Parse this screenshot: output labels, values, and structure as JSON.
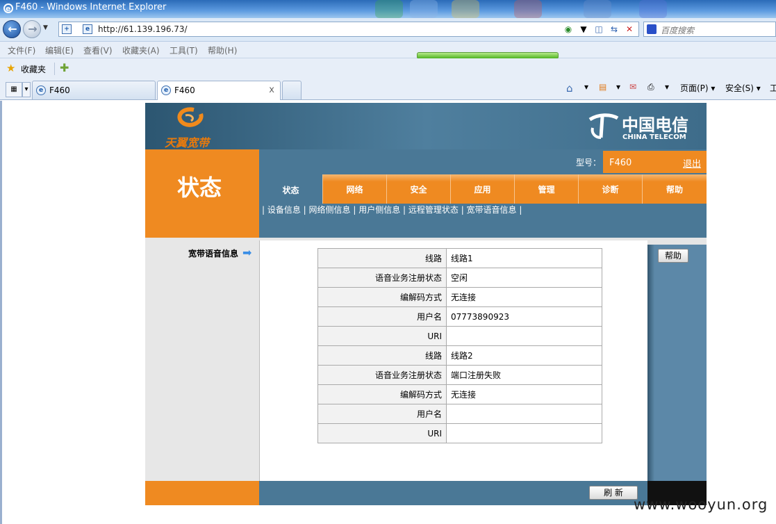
{
  "browser": {
    "window_title": "F460 - Windows Internet Explorer",
    "url": "http://61.139.196.73/",
    "search_placeholder": "百度搜索",
    "menu": [
      "文件(F)",
      "编辑(E)",
      "查看(V)",
      "收藏夹(A)",
      "工具(T)",
      "帮助(H)"
    ],
    "favorites_label": "收藏夹",
    "tabs": [
      {
        "label": "F460"
      },
      {
        "label": "F460",
        "close": "x"
      }
    ],
    "cmdbar": {
      "page": "页面(P) ▾",
      "safety": "安全(S) ▾",
      "tools": "工"
    }
  },
  "router": {
    "brand_cn": "天翼宽带",
    "operator_cn": "中国电信",
    "operator_en": "CHINA TELECOM",
    "section_title": "状态",
    "model_label": "型号：",
    "model_value": "F460",
    "logout": "退出",
    "tabs": [
      "状态",
      "网络",
      "安全",
      "应用",
      "管理",
      "诊断",
      "帮助"
    ],
    "sublinks": "| 设备信息 | 网络侧信息 | 用户侧信息 | 远程管理状态 | 宽带语音信息 |",
    "side_item": "宽带语音信息",
    "help_button": "帮助",
    "refresh_button": "刷 新",
    "rows": [
      {
        "label": "线路",
        "value": "线路1"
      },
      {
        "label": "语音业务注册状态",
        "value": "空闲"
      },
      {
        "label": "编解码方式",
        "value": "无连接"
      },
      {
        "label": "用户名",
        "value": "07773890923"
      },
      {
        "label": "URI",
        "value": ""
      },
      {
        "label": "线路",
        "value": "线路2"
      },
      {
        "label": "语音业务注册状态",
        "value": "端口注册失败"
      },
      {
        "label": "编解码方式",
        "value": "无连接"
      },
      {
        "label": "用户名",
        "value": ""
      },
      {
        "label": "URI",
        "value": ""
      }
    ]
  },
  "watermark": "www.wooyun.org",
  "colors": {
    "orange": "#ef8a21",
    "steel_blue": "#4a7896",
    "banner_blue": "#2c5671"
  }
}
